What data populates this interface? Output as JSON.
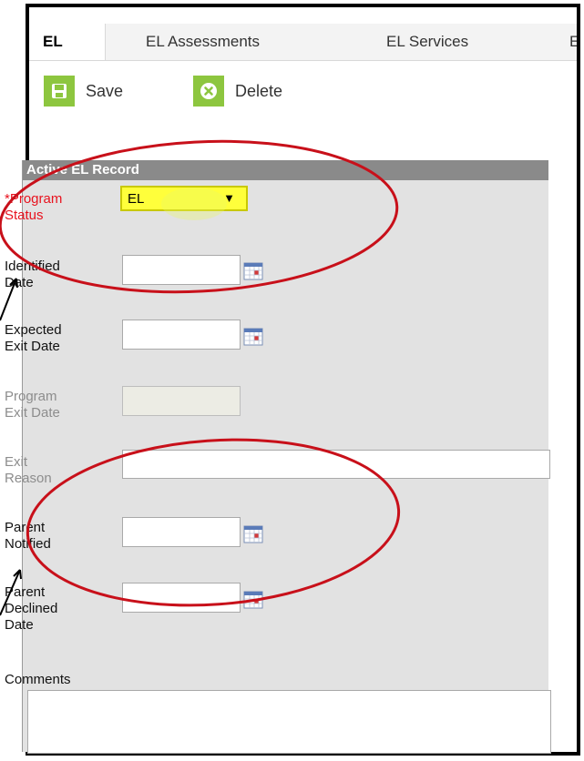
{
  "tabs": [
    {
      "label": "EL",
      "active": true
    },
    {
      "label": "EL Assessments"
    },
    {
      "label": "EL Services"
    },
    {
      "label": "E"
    }
  ],
  "toolbar": {
    "save_label": "Save",
    "delete_label": "Delete"
  },
  "panel": {
    "title": "Active EL Record"
  },
  "form": {
    "program_status": {
      "label_line1": "*Program",
      "label_line2": "Status",
      "value": "EL"
    },
    "identified_date": {
      "label_line1": "Identified",
      "label_line2": "Date"
    },
    "expected_exit_date": {
      "label_line1": "Expected",
      "label_line2": "Exit Date"
    },
    "program_exit_date": {
      "label_line1": "Program",
      "label_line2": "Exit Date"
    },
    "exit_reason": {
      "label_line1": "Exit",
      "label_line2": "Reason"
    },
    "parent_notified": {
      "label_line1": "Parent",
      "label_line2": "Notified"
    },
    "parent_declined_date": {
      "label_line1": "Parent",
      "label_line2": "Declined",
      "label_line3": "Date"
    },
    "comments": {
      "label": "Comments"
    }
  },
  "colors": {
    "toolbar_icon_green": "#8dc63f",
    "highlight_yellow": "#ffff3b",
    "required_red": "#e8121e",
    "annotation_red": "#c8101a"
  },
  "icons": [
    "save-icon",
    "delete-icon",
    "calendar-icon",
    "dropdown-arrow-icon"
  ]
}
